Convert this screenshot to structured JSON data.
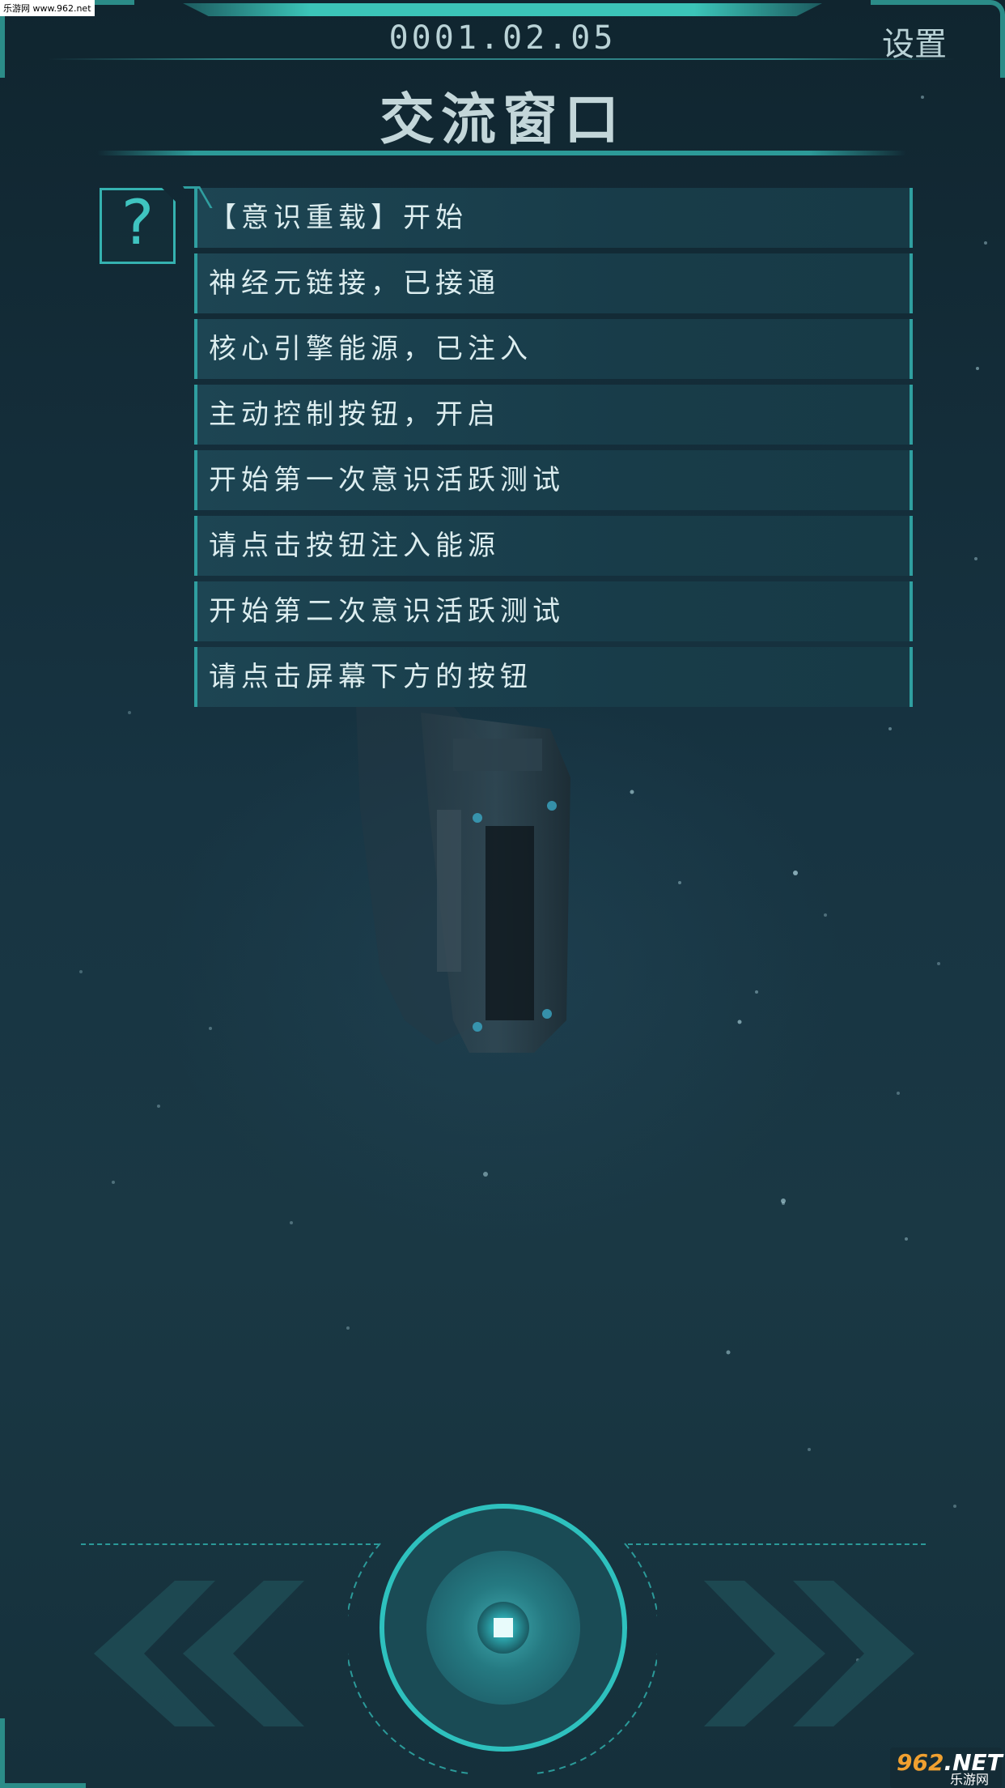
{
  "watermark_top": "乐游网 www.962.net",
  "header": {
    "date": "0001.02.05",
    "settings_label": "设置",
    "title": "交流窗口"
  },
  "help_icon": "question-mark-icon",
  "messages": [
    {
      "text": "【意识重载】开始"
    },
    {
      "text": "神经元链接，已接通"
    },
    {
      "text": "核心引擎能源，已注入"
    },
    {
      "text": "主动控制按钮，开启"
    },
    {
      "text": "开始第一次意识活跃测试"
    },
    {
      "text": "请点击按钮注入能源"
    },
    {
      "text": "开始第二次意识活跃测试"
    },
    {
      "text": "请点击屏幕下方的按钮"
    }
  ],
  "controls": {
    "prev_icon": "double-chevron-left-icon",
    "main_icon": "stop-square-icon",
    "next_icon": "double-chevron-right-icon"
  },
  "watermark_bottom": {
    "number": "962",
    "suffix": ".NET",
    "sub": "乐游网"
  },
  "colors": {
    "accent": "#3bc4b8",
    "panel": "#183c49",
    "text": "#dcedef",
    "background": "#15303b"
  }
}
